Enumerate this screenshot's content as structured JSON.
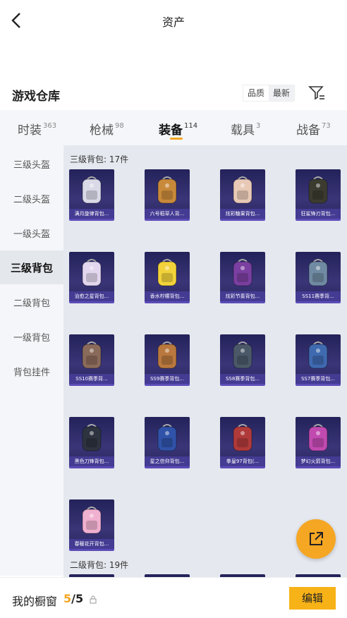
{
  "header": {
    "title": "资产",
    "back_icon": "back-arrow-icon"
  },
  "section": {
    "title": "游戏仓库",
    "sort": [
      "品质",
      "最新"
    ],
    "active_sort": "最新",
    "filter_icon": "filter-icon"
  },
  "tabs": [
    {
      "label": "时装",
      "count": "363"
    },
    {
      "label": "枪械",
      "count": "98"
    },
    {
      "label": "装备",
      "count": "114"
    },
    {
      "label": "载具",
      "count": "3"
    },
    {
      "label": "战备",
      "count": "73"
    }
  ],
  "active_tab": "装备",
  "sidebar": {
    "items": [
      "三级头盔",
      "二级头盔",
      "一级头盔",
      "三级背包",
      "二级背包",
      "一级背包",
      "背包挂件"
    ],
    "active": "三级背包"
  },
  "groups": [
    {
      "label": "三级背包: 17件",
      "items": [
        "满月旋律背包...",
        "六号稻草人背...",
        "炫彩糖果背包...",
        "狂鲨锋刃背包...",
        "治愈之星背包...",
        "香水柠檬背包...",
        "炫彩节奏背包...",
        "SS11赛季背...",
        "SS10赛季背...",
        "SS9赛季背包...",
        "SS8赛季背包...",
        "SS7赛季背包...",
        "黑色刀锋背包...",
        "星之信仰背包...",
        "拳皇97背包(...",
        "梦幻火箭背包...",
        "春暖花开背包..."
      ]
    },
    {
      "label": "二级背包: 19件",
      "items": []
    }
  ],
  "fab": {
    "icon": "share-external-icon"
  },
  "bottom": {
    "wardrobe_label": "我的橱窗",
    "count_current": "5",
    "count_sep": "/5",
    "lock_icon": "lock-icon",
    "edit_label": "编辑"
  },
  "colors": {
    "accent": "#f5a623",
    "card_bg": "#2e2b6a",
    "card_caption": "#463c96"
  }
}
